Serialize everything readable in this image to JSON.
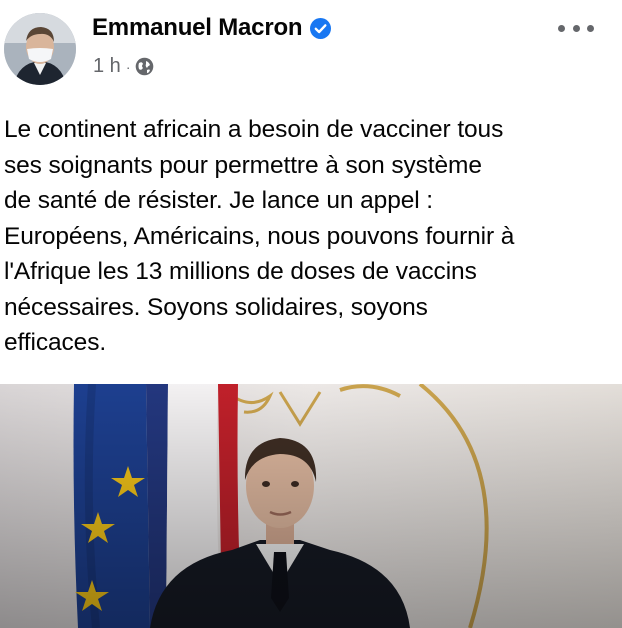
{
  "post": {
    "author": "Emmanuel Macron",
    "time": "1 h",
    "separator": "·",
    "text": "Le continent africain a besoin de vacciner tous\nses soignants pour permettre à son système\nde santé de résister. Je lance un appel :\nEuropéens, Américains, nous pouvons fournir à\nl'Afrique les 13 millions de doses de vaccins\nnécessaires. Soyons solidaires, soyons\nefficaces.",
    "icons": {
      "verified": "verified-badge-icon",
      "audience": "globe-icon",
      "menu": "more-options-icon"
    }
  },
  "colors": {
    "verified_blue": "#1877f2",
    "meta_gray": "#65676b",
    "eu_blue": "#1d3f8f",
    "star_yellow": "#f2c318",
    "flag_red": "#c0202a"
  }
}
